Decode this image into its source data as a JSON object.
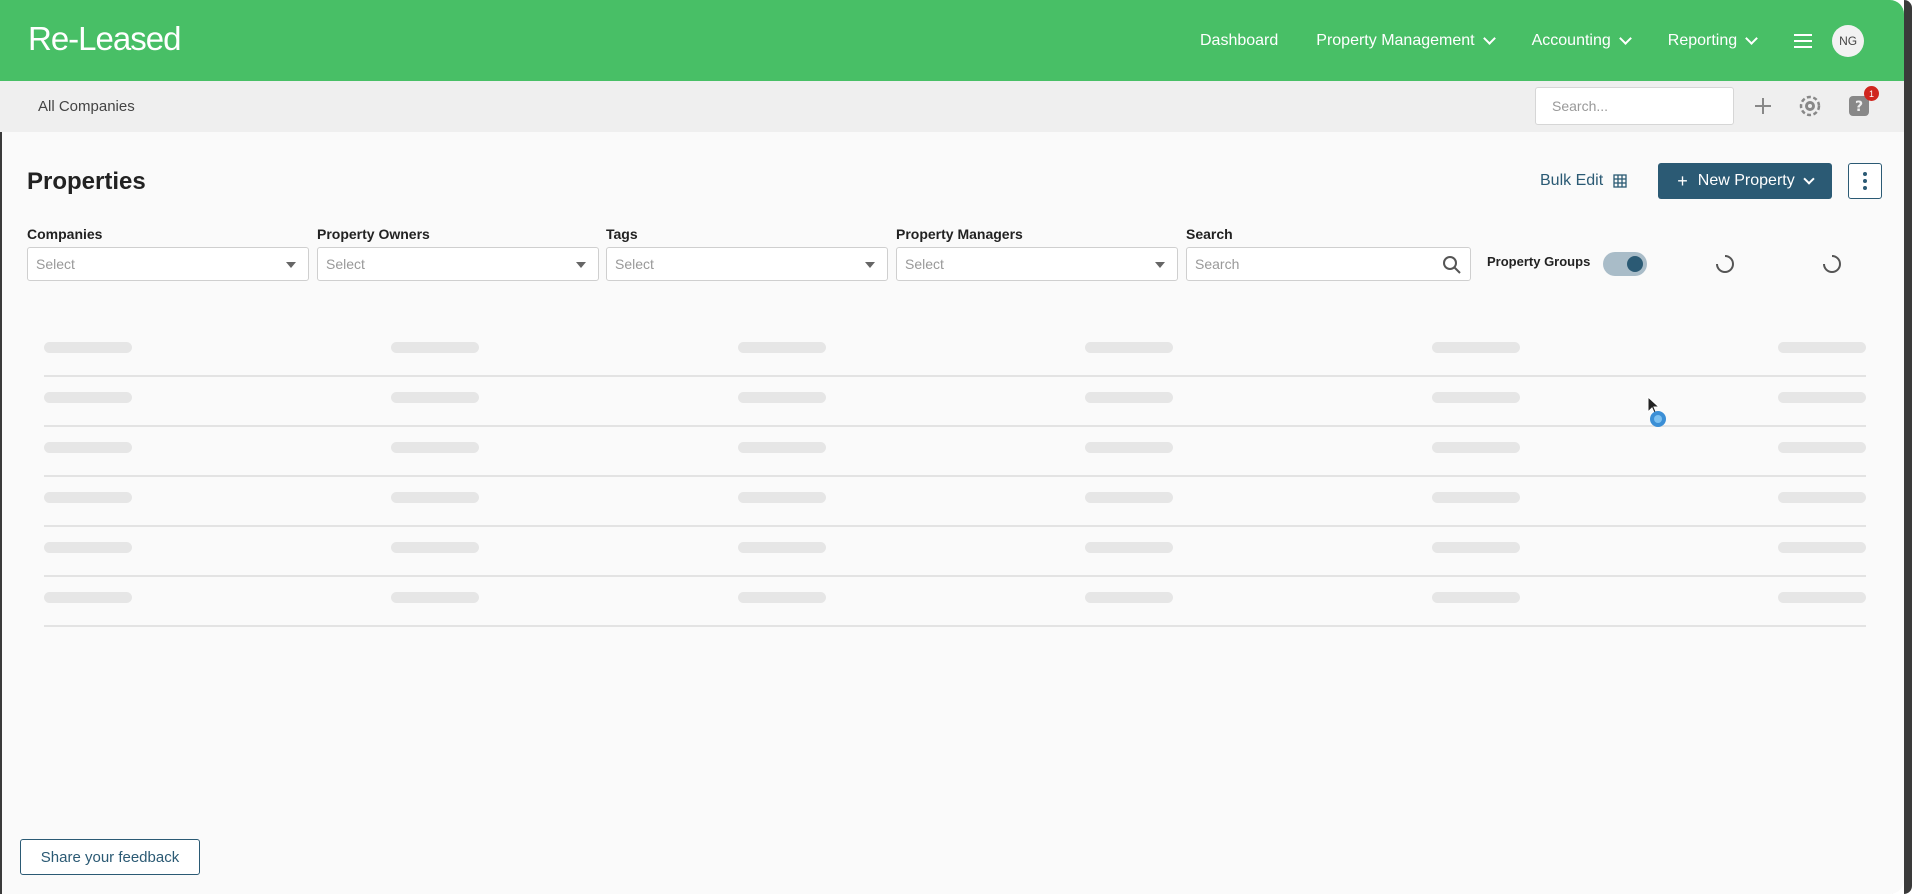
{
  "app": {
    "logo": "Re-Leased",
    "nav": [
      {
        "label": "Dashboard",
        "dropdown": false
      },
      {
        "label": "Property Management",
        "dropdown": true
      },
      {
        "label": "Accounting",
        "dropdown": true
      },
      {
        "label": "Reporting",
        "dropdown": true
      }
    ],
    "avatar_initials": "NG",
    "brand_color": "#48bf66",
    "accent_color": "#2b5a74"
  },
  "subbar": {
    "breadcrumb": "All Companies",
    "search_placeholder": "Search...",
    "notification_count": "1"
  },
  "page": {
    "title": "Properties",
    "bulk_edit_label": "Bulk Edit",
    "new_property_label": "New Property",
    "filters": [
      {
        "label": "Companies",
        "placeholder": "Select"
      },
      {
        "label": "Property Owners",
        "placeholder": "Select"
      },
      {
        "label": "Tags",
        "placeholder": "Select"
      },
      {
        "label": "Property Managers",
        "placeholder": "Select"
      }
    ],
    "search": {
      "label": "Search",
      "placeholder": "Search"
    },
    "property_groups": {
      "label": "Property Groups",
      "enabled": true
    }
  },
  "feedback_label": "Share your feedback"
}
